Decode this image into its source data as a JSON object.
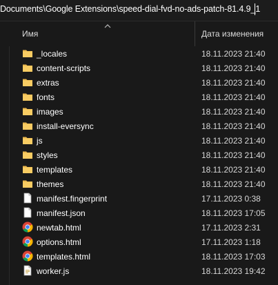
{
  "address_bar": {
    "segments": [
      "Documents",
      "Google Extensions",
      "speed-dial-fvd-no-ads-patch-81.4.9_1"
    ],
    "separator": "\\"
  },
  "header": {
    "name_label": "Имя",
    "date_label": "Дата изменения"
  },
  "files": [
    {
      "name": "_locales",
      "date": "18.11.2023 21:40",
      "type": "folder"
    },
    {
      "name": "content-scripts",
      "date": "18.11.2023 21:40",
      "type": "folder"
    },
    {
      "name": "extras",
      "date": "18.11.2023 21:40",
      "type": "folder"
    },
    {
      "name": "fonts",
      "date": "18.11.2023 21:40",
      "type": "folder"
    },
    {
      "name": "images",
      "date": "18.11.2023 21:40",
      "type": "folder"
    },
    {
      "name": "install-eversync",
      "date": "18.11.2023 21:40",
      "type": "folder"
    },
    {
      "name": "js",
      "date": "18.11.2023 21:40",
      "type": "folder"
    },
    {
      "name": "styles",
      "date": "18.11.2023 21:40",
      "type": "folder"
    },
    {
      "name": "templates",
      "date": "18.11.2023 21:40",
      "type": "folder"
    },
    {
      "name": "themes",
      "date": "18.11.2023 21:40",
      "type": "folder"
    },
    {
      "name": "manifest.fingerprint",
      "date": "17.11.2023 0:38",
      "type": "file"
    },
    {
      "name": "manifest.json",
      "date": "18.11.2023 17:05",
      "type": "file"
    },
    {
      "name": "newtab.html",
      "date": "17.11.2023 2:31",
      "type": "chrome"
    },
    {
      "name": "options.html",
      "date": "17.11.2023 1:18",
      "type": "chrome"
    },
    {
      "name": "templates.html",
      "date": "18.11.2023 17:03",
      "type": "chrome"
    },
    {
      "name": "worker.js",
      "date": "18.11.2023 19:42",
      "type": "js"
    }
  ],
  "colors": {
    "background": "#191919",
    "folder": "#f5c55a",
    "text": "#ffffff"
  }
}
